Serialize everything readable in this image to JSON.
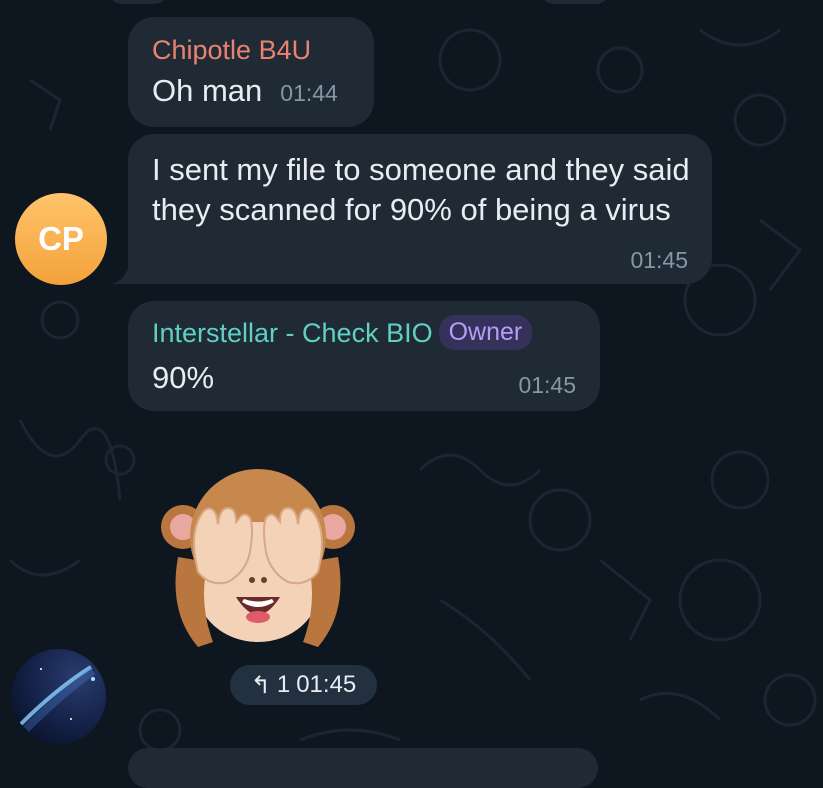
{
  "messages": [
    {
      "sender": "Chipotle B4U",
      "text": "Oh man",
      "time": "01:44"
    },
    {
      "text": "I sent my file to someone and they said they scanned for 90% of being a virus",
      "time": "01:45"
    },
    {
      "sender": "Interstellar - Check BIO",
      "badge": "Owner",
      "text": "90%",
      "time": "01:45"
    }
  ],
  "avatars": {
    "cp_initials": "CP"
  },
  "sticker": {
    "name": "see-no-evil-monkey",
    "reply_count": "1",
    "time": "01:45"
  },
  "colors": {
    "background": "#0e1620",
    "bubble": "#1f2a35",
    "sender_chipotle": "#e9836f",
    "sender_interstellar": "#5fd0c2",
    "owner_badge": "#b39ef5",
    "avatar_cp": "#f7ad45"
  }
}
